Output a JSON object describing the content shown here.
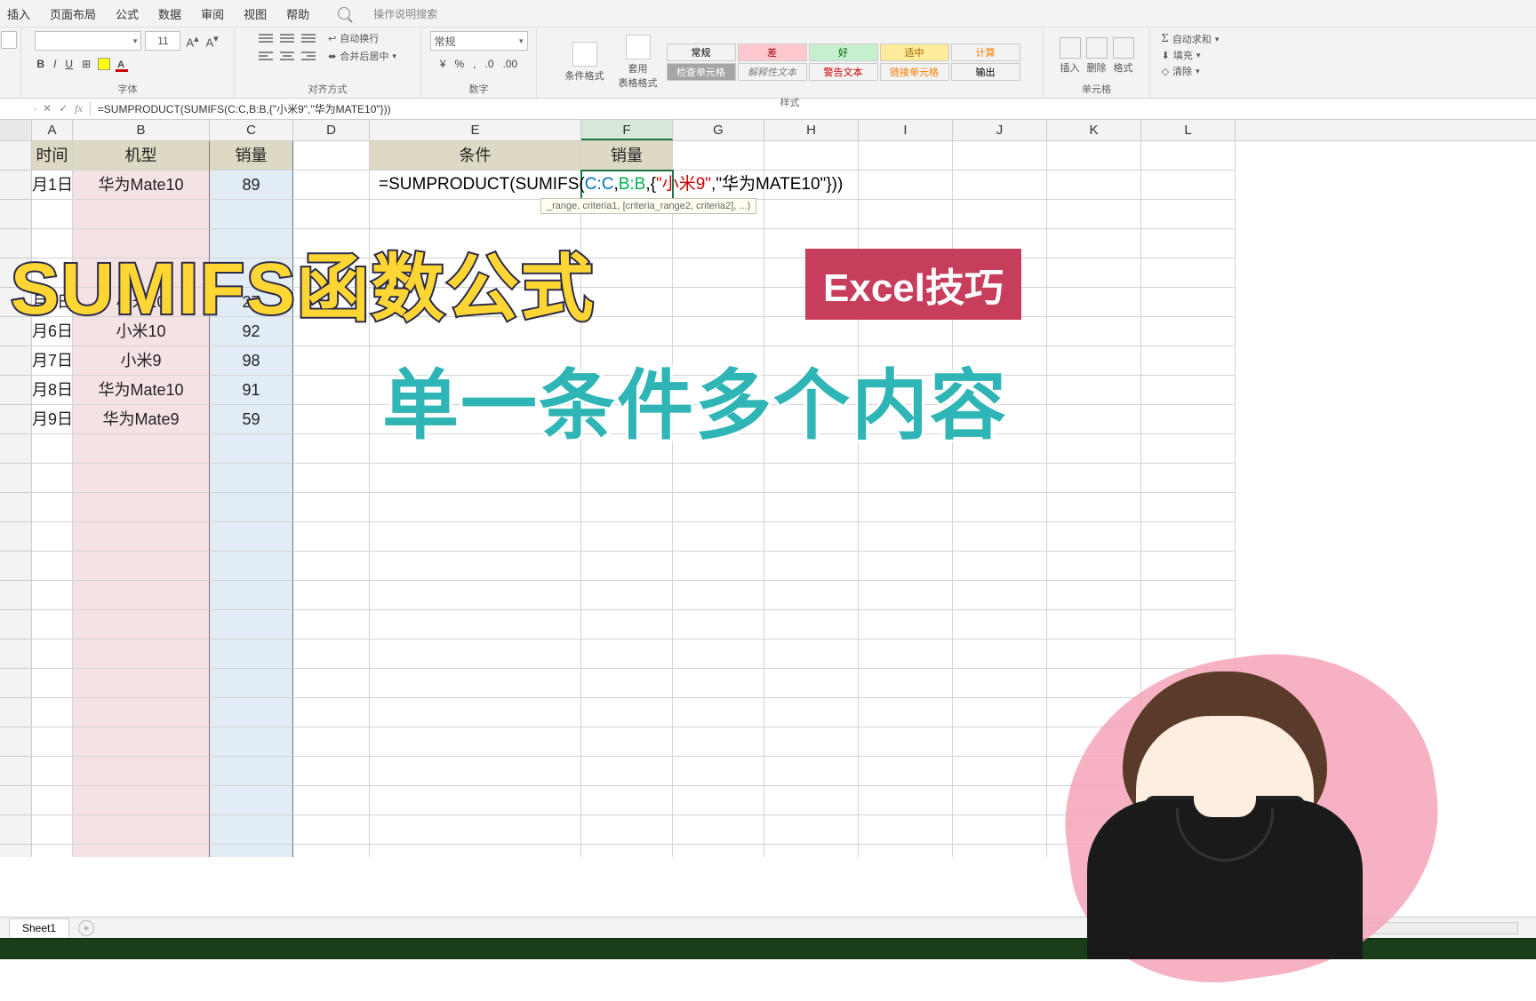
{
  "tabs": {
    "insert": "插入",
    "layout": "页面布局",
    "formula": "公式",
    "data": "数据",
    "review": "审阅",
    "view": "视图",
    "help": "帮助",
    "search": "操作说明搜索"
  },
  "ribbon": {
    "font": {
      "label": "字体",
      "size": "11",
      "bold": "B",
      "italic": "I",
      "underline": "U"
    },
    "align": {
      "label": "对齐方式",
      "wrap": "自动换行",
      "merge": "合并后居中"
    },
    "number": {
      "label": "数字",
      "general": "常规"
    },
    "styles": {
      "label": "样式",
      "cond": "条件格式",
      "table": "套用\n表格格式",
      "r1": [
        "常规",
        "差",
        "好",
        "适中",
        "计算"
      ],
      "r2": [
        "检查单元格",
        "解释性文本",
        "警告文本",
        "链接单元格",
        "输出"
      ]
    },
    "cells": {
      "label": "单元格",
      "insert": "插入",
      "delete": "删除",
      "format": "格式"
    },
    "edit": {
      "sum": "自动求和",
      "fill": "填充",
      "clear": "清除"
    }
  },
  "formula_bar": {
    "fx": "fx",
    "text": "=SUMPRODUCT(SUMIFS(C:C,B:B,{\"小米9\",\"华为MATE10\"}))"
  },
  "columns": [
    "A",
    "B",
    "C",
    "D",
    "E",
    "F",
    "G",
    "H",
    "I",
    "J",
    "K",
    "L"
  ],
  "headers": {
    "A": "时间",
    "B": "机型",
    "C": "销量",
    "E": "条件",
    "F": "销量"
  },
  "table": [
    {
      "a": "月1日",
      "b": "华为Mate10",
      "c": "89"
    },
    {
      "a": "",
      "b": "",
      "c": ""
    },
    {
      "a": "",
      "b": "",
      "c": ""
    },
    {
      "a": "",
      "b": "",
      "c": ""
    },
    {
      "a": "月5日",
      "b": "小米10",
      "c": "27"
    },
    {
      "a": "月6日",
      "b": "小米10",
      "c": "92"
    },
    {
      "a": "月7日",
      "b": "小米9",
      "c": "98"
    },
    {
      "a": "月8日",
      "b": "华为Mate10",
      "c": "91"
    },
    {
      "a": "月9日",
      "b": "华为Mate9",
      "c": "59"
    }
  ],
  "cell_formula": {
    "pre": "=SUMPRODUCT(SUMIFS(",
    "r1": "C:C",
    "c1": ",",
    "r2": "B:B",
    "c2": ",{",
    "s1": "\"小米9\"",
    "c3": ",",
    "s2": "\"华为MATE10\"",
    "post": "}))"
  },
  "tooltip": "_range, criteria1, [criteria_range2, criteria2], ...)",
  "overlay": {
    "t1": "SUMIFS函数公式",
    "badge": "Excel技巧",
    "t2": "单一条件多个内容"
  },
  "sheet": {
    "tab": "Sheet1"
  }
}
